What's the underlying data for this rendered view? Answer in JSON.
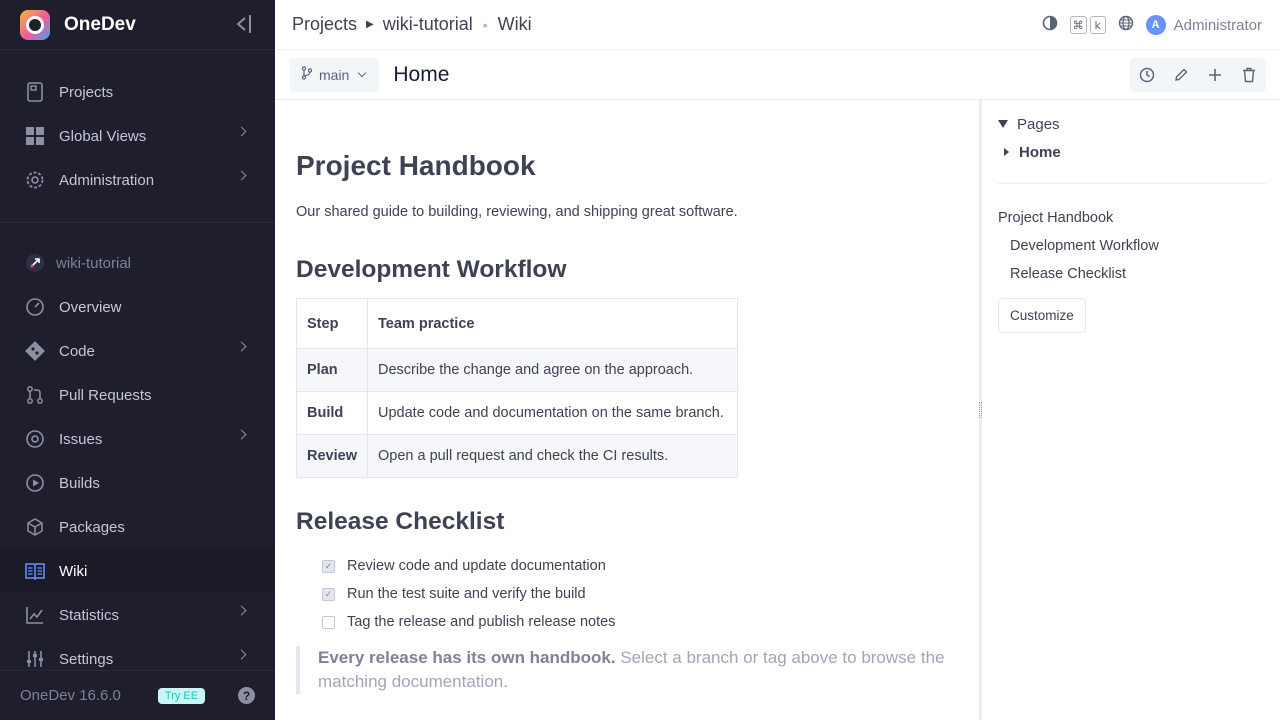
{
  "app": {
    "name": "OneDev",
    "version": "OneDev 16.6.0",
    "try_ee": "Try EE",
    "help": "?"
  },
  "sidebar": {
    "global_items": [
      {
        "label": "Projects",
        "icon": "projects-icon"
      },
      {
        "label": "Global Views",
        "icon": "global-views-icon"
      },
      {
        "label": "Administration",
        "icon": "administration-icon"
      }
    ],
    "project_name": "wiki-tutorial",
    "project_items": [
      {
        "label": "Overview"
      },
      {
        "label": "Code"
      },
      {
        "label": "Pull Requests"
      },
      {
        "label": "Issues"
      },
      {
        "label": "Builds"
      },
      {
        "label": "Packages"
      },
      {
        "label": "Wiki"
      },
      {
        "label": "Statistics"
      },
      {
        "label": "Settings"
      }
    ],
    "active_item": "Wiki"
  },
  "header": {
    "breadcrumb": [
      "Projects",
      "wiki-tutorial",
      "Wiki"
    ],
    "shortcut_keys": [
      "⌘",
      "k"
    ],
    "user_initial": "A",
    "user_name": "Administrator"
  },
  "subbar": {
    "branch": "main",
    "page_title": "Home"
  },
  "doc": {
    "title": "Project Handbook",
    "intro": "Our shared guide to building, reviewing, and shipping great software.",
    "workflow_heading": "Development Workflow",
    "table_headers": [
      "Step",
      "Team practice"
    ],
    "table_rows": [
      {
        "step": "Plan",
        "practice": "Describe the change and agree on the approach."
      },
      {
        "step": "Build",
        "practice": "Update code and documentation on the same branch."
      },
      {
        "step": "Review",
        "practice": "Open a pull request and check the CI results."
      }
    ],
    "checklist_heading": "Release Checklist",
    "checklist": [
      {
        "text": "Review code and update documentation",
        "checked": true
      },
      {
        "text": "Run the test suite and verify the build",
        "checked": true
      },
      {
        "text": "Tag the release and publish release notes",
        "checked": false
      }
    ],
    "quote_bold": "Every release has its own handbook.",
    "quote_text": " Select a branch or tag above to browse the matching documentation."
  },
  "panel": {
    "pages_label": "Pages",
    "home_label": "Home",
    "toc": [
      "Project Handbook",
      "Development Workflow",
      "Release Checklist"
    ],
    "customize_label": "Customize"
  },
  "colors": {
    "sidebar_bg": "#1e1e2d",
    "accent": "#6993ff",
    "try_ee_bg": "#c9f7f5"
  }
}
